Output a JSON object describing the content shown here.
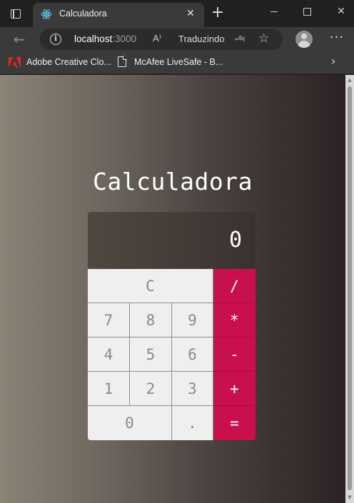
{
  "browser": {
    "tab": {
      "title": "Calculadora",
      "favicon": "react-icon",
      "close_icon": "✕"
    },
    "new_tab_icon": "+",
    "address": {
      "host": "localhost",
      "port": ":3000",
      "read_aloud_icon": "A⁾",
      "translate_label": "Traduzindo",
      "translate_icon": "அ",
      "favorite_icon": "☆"
    },
    "menu_icon": "···",
    "favorites": [
      {
        "label": "Adobe Creative Clo...",
        "icon": "adobe-icon"
      },
      {
        "label": "McAfee LiveSafe - B...",
        "icon": "page-icon"
      }
    ],
    "favorites_more_icon": "›"
  },
  "app": {
    "title": "Calculadora",
    "display": "0",
    "keys": {
      "clear": "C",
      "divide": "/",
      "multiply": "*",
      "subtract": "-",
      "add": "+",
      "equals": "=",
      "seven": "7",
      "eight": "8",
      "nine": "9",
      "four": "4",
      "five": "5",
      "six": "6",
      "one": "1",
      "two": "2",
      "three": "3",
      "zero": "0",
      "decimal": "."
    }
  },
  "colors": {
    "operator": "#c8104c",
    "key": "#efefef",
    "display": "#4a433d"
  }
}
